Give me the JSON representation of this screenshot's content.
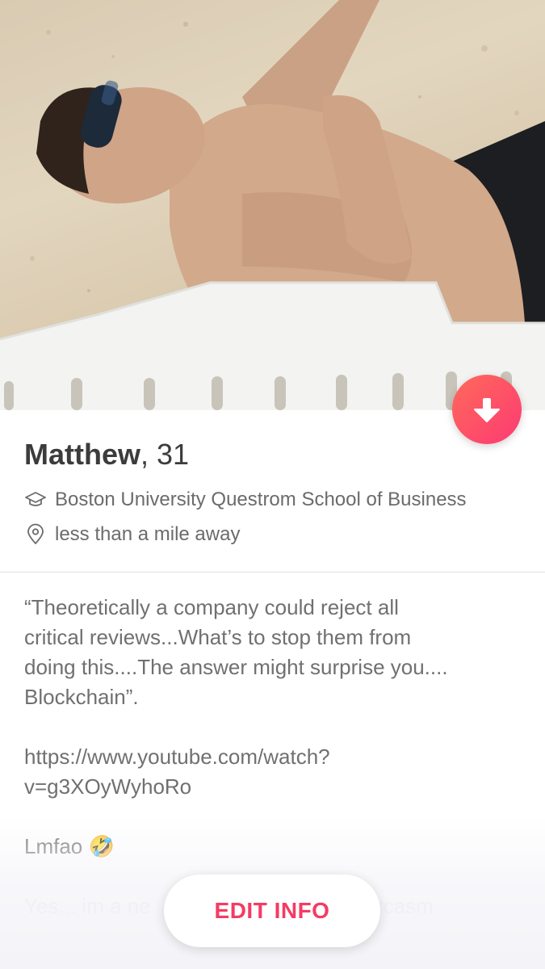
{
  "profile": {
    "name": "Matthew",
    "age": "31",
    "name_separator": ",",
    "school": "Boston University Questrom School of Business",
    "distance": "less than a mile away"
  },
  "bio": {
    "quote_line1": "“Theoretically a company could reject all",
    "quote_line2": "critical reviews...What’s to stop them from",
    "quote_line3": "doing this....The answer might surprise you....",
    "quote_line4": "Blockchain”.",
    "link_line1": "https://www.youtube.com/watch?",
    "link_line2": "v=g3XOyWyhoRo",
    "reaction": "Lmfao 🤣",
    "next_line": "Yes... im a ne",
    "next_line_tail": "arcasm"
  },
  "actions": {
    "edit_info_label": "EDIT INFO"
  },
  "icons": {
    "collapse": "arrow-down-icon",
    "school": "graduation-cap-icon",
    "distance": "location-pin-icon"
  },
  "colors": {
    "accent_start": "#fe6a5a",
    "accent_end": "#fd3a73",
    "edit_text": "#f53b63"
  }
}
